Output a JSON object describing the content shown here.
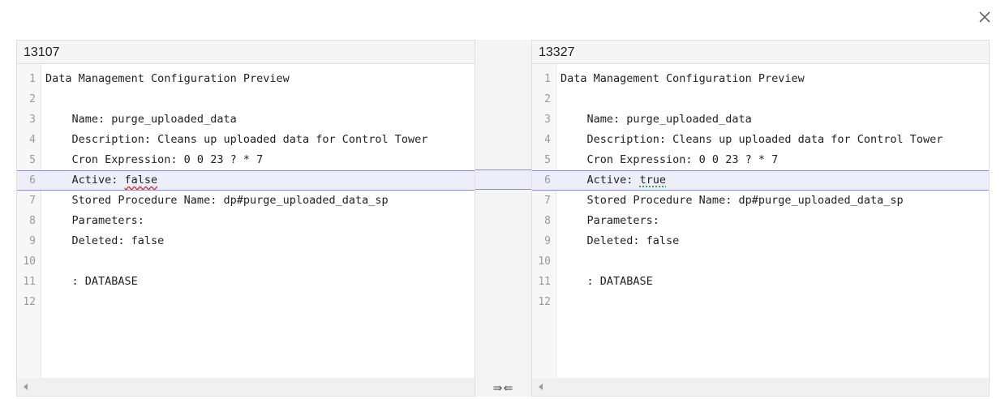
{
  "close_icon": "close-icon",
  "left": {
    "title": "13107",
    "lines": [
      {
        "n": "1",
        "pre": "Data Management Configuration Preview",
        "mark": "",
        "post": ""
      },
      {
        "n": "2",
        "pre": "",
        "mark": "",
        "post": ""
      },
      {
        "n": "3",
        "pre": "    Name: purge_uploaded_data",
        "mark": "",
        "post": ""
      },
      {
        "n": "4",
        "pre": "    Description: Cleans up uploaded data for Control Tower",
        "mark": "",
        "post": ""
      },
      {
        "n": "5",
        "pre": "    Cron Expression: 0 0 23 ? * 7",
        "mark": "",
        "post": ""
      },
      {
        "n": "6",
        "pre": "    Active: ",
        "mark": "false",
        "post": ""
      },
      {
        "n": "7",
        "pre": "    Stored Procedure Name: dp#purge_uploaded_data_sp",
        "mark": "",
        "post": ""
      },
      {
        "n": "8",
        "pre": "    Parameters:",
        "mark": "",
        "post": ""
      },
      {
        "n": "9",
        "pre": "    Deleted: false",
        "mark": "",
        "post": ""
      },
      {
        "n": "10",
        "pre": "",
        "mark": "",
        "post": ""
      },
      {
        "n": "11",
        "pre": "    : DATABASE",
        "mark": "",
        "post": ""
      },
      {
        "n": "12",
        "pre": "",
        "mark": "",
        "post": ""
      }
    ]
  },
  "right": {
    "title": "13327",
    "lines": [
      {
        "n": "1",
        "pre": "Data Management Configuration Preview",
        "mark": "",
        "post": ""
      },
      {
        "n": "2",
        "pre": "",
        "mark": "",
        "post": ""
      },
      {
        "n": "3",
        "pre": "    Name: purge_uploaded_data",
        "mark": "",
        "post": ""
      },
      {
        "n": "4",
        "pre": "    Description: Cleans up uploaded data for Control Tower",
        "mark": "",
        "post": ""
      },
      {
        "n": "5",
        "pre": "    Cron Expression: 0 0 23 ? * 7",
        "mark": "",
        "post": ""
      },
      {
        "n": "6",
        "pre": "    Active: ",
        "mark": "true",
        "post": ""
      },
      {
        "n": "7",
        "pre": "    Stored Procedure Name: dp#purge_uploaded_data_sp",
        "mark": "",
        "post": ""
      },
      {
        "n": "8",
        "pre": "    Parameters:",
        "mark": "",
        "post": ""
      },
      {
        "n": "9",
        "pre": "    Deleted: false",
        "mark": "",
        "post": ""
      },
      {
        "n": "10",
        "pre": "",
        "mark": "",
        "post": ""
      },
      {
        "n": "11",
        "pre": "    : DATABASE",
        "mark": "",
        "post": ""
      },
      {
        "n": "12",
        "pre": "",
        "mark": "",
        "post": ""
      }
    ]
  },
  "merge_buttons": "⇛⇚",
  "colors": {
    "changed_bg": "#eeeefb",
    "changed_border": "#8c8cdc",
    "deleted_underline": "#d93025",
    "inserted_underline": "#34a853"
  }
}
